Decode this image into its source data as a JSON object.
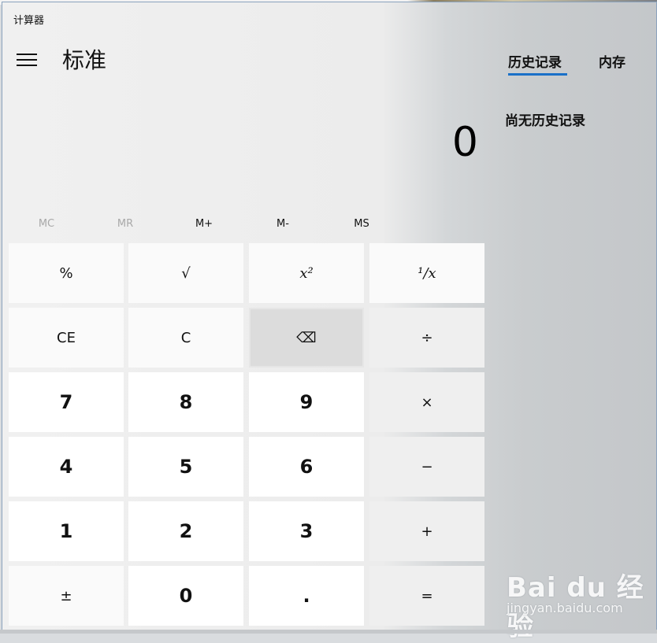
{
  "window": {
    "title": "计算器"
  },
  "header": {
    "mode": "标准"
  },
  "display": {
    "value": "0"
  },
  "memory": {
    "buttons": [
      {
        "label": "MC",
        "enabled": false
      },
      {
        "label": "MR",
        "enabled": false
      },
      {
        "label": "M+",
        "enabled": true
      },
      {
        "label": "M-",
        "enabled": true
      },
      {
        "label": "MS",
        "enabled": true
      }
    ]
  },
  "keypad": {
    "rows": [
      [
        "%",
        "√",
        "x²",
        "¹/x"
      ],
      [
        "CE",
        "C",
        "⌫",
        "÷"
      ],
      [
        "7",
        "8",
        "9",
        "×"
      ],
      [
        "4",
        "5",
        "6",
        "−"
      ],
      [
        "1",
        "2",
        "3",
        "+"
      ],
      [
        "±",
        "0",
        ".",
        "="
      ]
    ]
  },
  "panel": {
    "tabs": [
      "历史记录",
      "内存"
    ],
    "active_tab": "历史记录",
    "empty_message": "尚无历史记录"
  },
  "watermark": {
    "brand": "Bai du 经验",
    "url": "jingyan.baidu.com"
  },
  "colors": {
    "accent": "#1a70c8"
  }
}
